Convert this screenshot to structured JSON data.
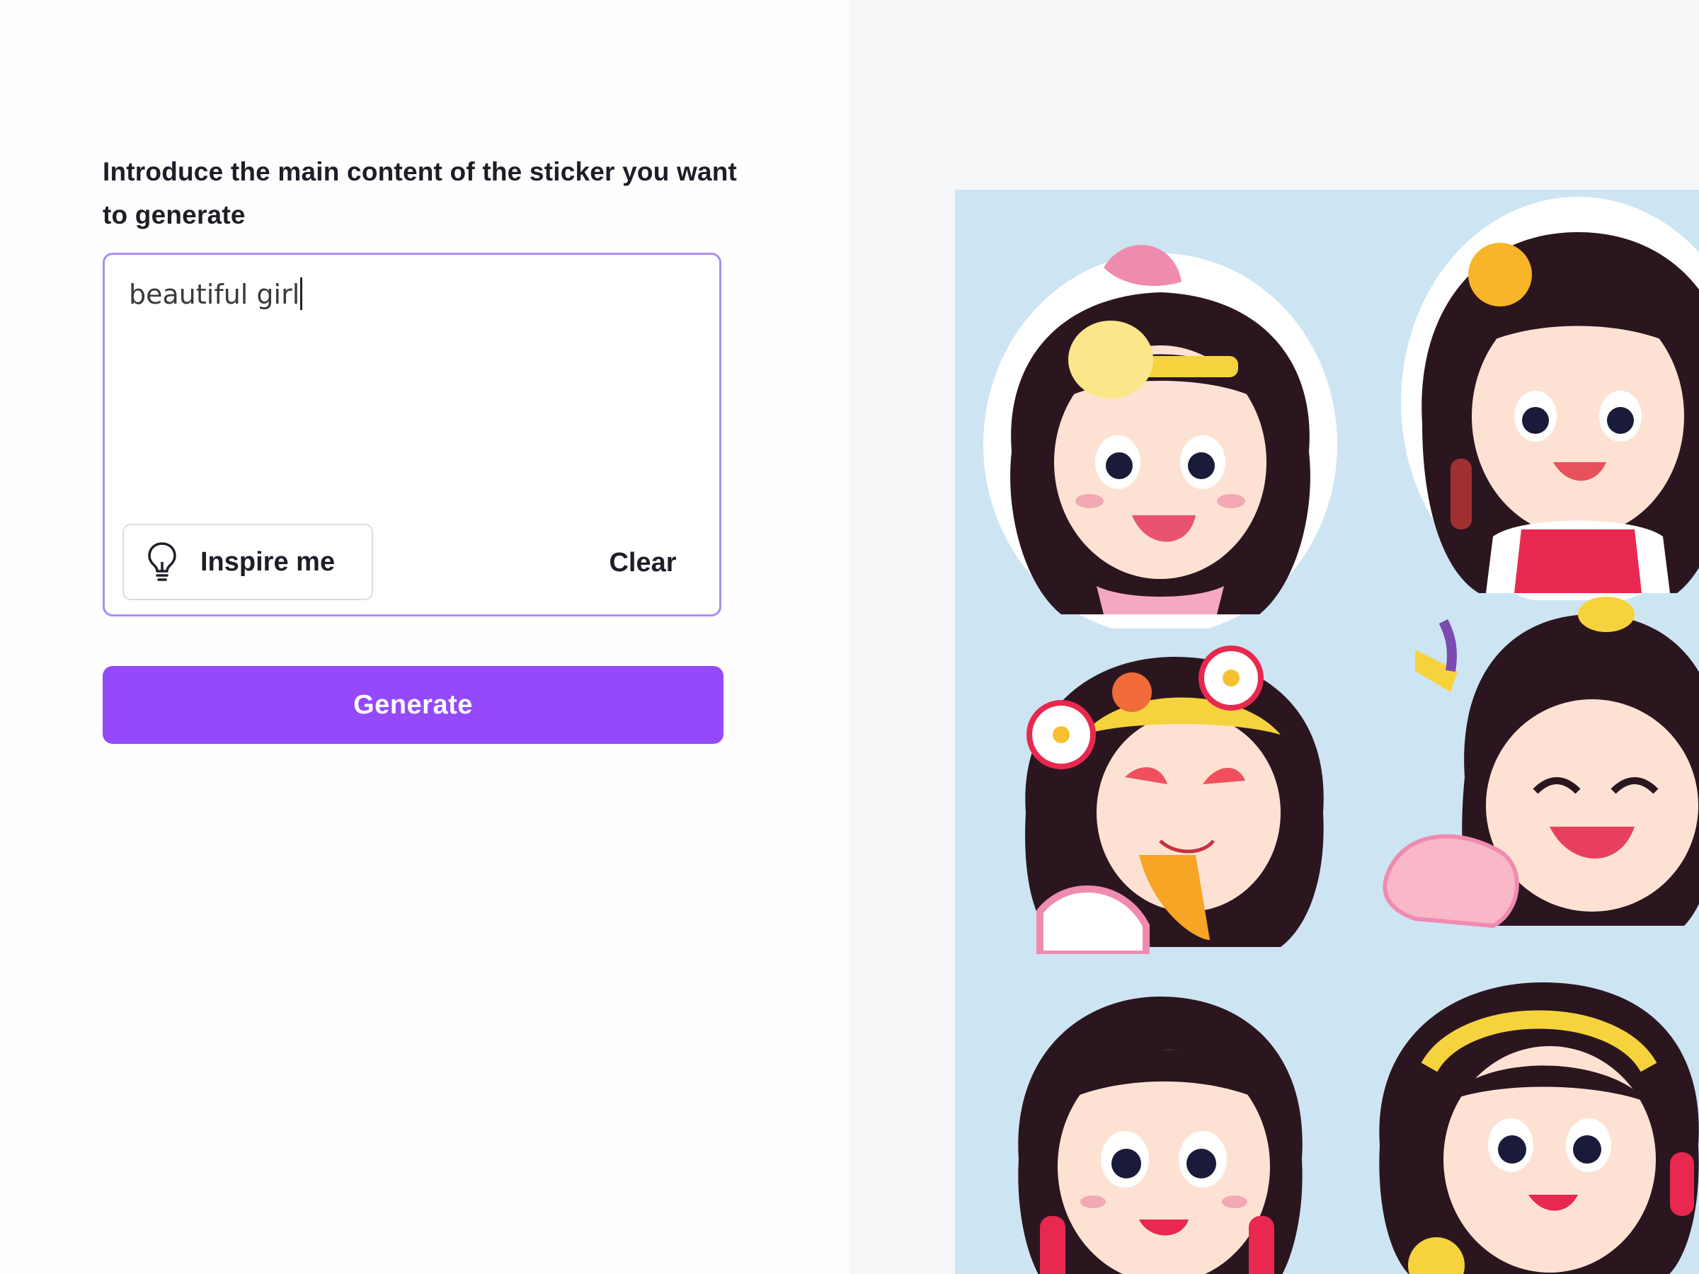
{
  "prompt": {
    "label": "Introduce the main content of the sticker you want to generate",
    "value": "beautiful girl"
  },
  "actions": {
    "inspire_label": "Inspire me",
    "clear_label": "Clear",
    "generate_label": "Generate"
  },
  "colors": {
    "accent": "#9449fb",
    "focus_border": "#a98ff0",
    "preview_background": "#cde5f3",
    "right_panel_background": "#f5f6f8"
  },
  "icons": {
    "inspire": "lightbulb-icon"
  },
  "preview": {
    "stickers": [
      {
        "name": "sticker-girl-flower-crown-smiling"
      },
      {
        "name": "sticker-girl-yellow-flower-red-dress"
      },
      {
        "name": "sticker-girl-flowers-eyes-closed"
      },
      {
        "name": "sticker-girl-laughing-eyes-closed"
      },
      {
        "name": "sticker-girl-open-mouth"
      },
      {
        "name": "sticker-girl-yellow-headband-smiling"
      }
    ]
  }
}
